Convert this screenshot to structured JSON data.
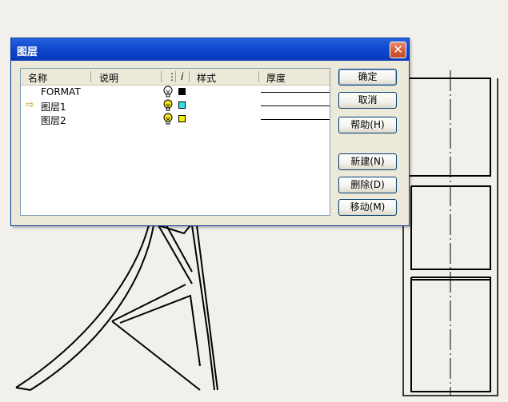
{
  "dialog": {
    "title": "图层",
    "close_glyph": "✕",
    "columns": {
      "name": "名称",
      "description": "说明",
      "visibility_symbol": "⋮",
      "color_symbol": "i",
      "linestyle": "样式",
      "thickness": "厚度"
    },
    "layers": [
      {
        "name": "FORMAT",
        "active": false,
        "visible": true,
        "bulb_color": "#ffffff",
        "color": "#000000",
        "linestyle": "solid",
        "thickness": "thin"
      },
      {
        "name": "图层1",
        "active": true,
        "visible": true,
        "bulb_color": "#f5e21a",
        "color": "#33e0e8",
        "linestyle": "dash-dot",
        "thickness": "thin"
      },
      {
        "name": "图层2",
        "active": false,
        "visible": true,
        "bulb_color": "#f5e21a",
        "color": "#f5f000",
        "linestyle": "dashed",
        "thickness": "thin"
      }
    ],
    "active_marker": "⇨",
    "buttons": {
      "ok": "确定",
      "cancel": "取消",
      "help": "帮助(H)",
      "new": "新建(N)",
      "delete": "删除(D)",
      "move": "移动(M)"
    },
    "colors": {
      "title_bar": "#0a43c8",
      "dialog_bg": "#ece9d8",
      "close_button": "#d35a37"
    }
  }
}
